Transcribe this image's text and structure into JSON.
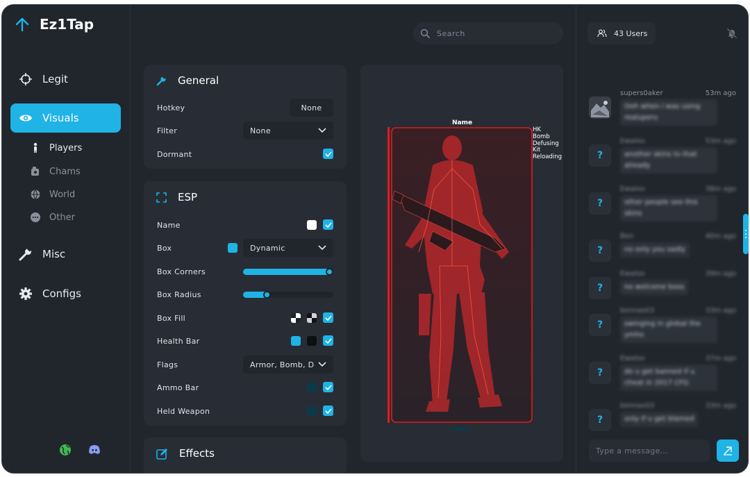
{
  "app": {
    "title": "Ez1Tap"
  },
  "sidebar": {
    "items": [
      {
        "label": "Legit",
        "icon": "crosshair-icon"
      },
      {
        "label": "Visuals",
        "icon": "eye-icon",
        "active": true
      },
      {
        "label": "Misc",
        "icon": "wrench-icon"
      },
      {
        "label": "Configs",
        "icon": "gear-icon"
      }
    ],
    "subitems": [
      {
        "label": "Players",
        "icon": "person-icon",
        "active": true
      },
      {
        "label": "Chams",
        "icon": "paint-icon"
      },
      {
        "label": "World",
        "icon": "globe-icon"
      },
      {
        "label": "Other",
        "icon": "more-icon"
      }
    ],
    "footer_icons": [
      "globe-icon",
      "discord-icon"
    ]
  },
  "search": {
    "placeholder": "Search"
  },
  "general": {
    "title": "General",
    "hotkey_label": "Hotkey",
    "hotkey_value": "None",
    "filter_label": "Filter",
    "filter_value": "None",
    "dormant_label": "Dormant",
    "dormant_checked": true
  },
  "esp": {
    "title": "ESP",
    "name_label": "Name",
    "box_label": "Box",
    "box_value": "Dynamic",
    "box_corners_label": "Box Corners",
    "box_corners_value": 1.0,
    "box_radius_label": "Box Radius",
    "box_radius_value": 0.27,
    "box_fill_label": "Box Fill",
    "health_bar_label": "Health Bar",
    "flags_label": "Flags",
    "flags_value": "Armor, Bomb, D",
    "ammo_bar_label": "Ammo Bar",
    "held_weapon_label": "Held Weapon"
  },
  "effects": {
    "title": "Effects"
  },
  "preview": {
    "name_tag": "Name",
    "flags": [
      "HK",
      "Bomb",
      "Defusing",
      "Kit",
      "Reloading"
    ]
  },
  "chat": {
    "users": "43 Users",
    "messages": [
      {
        "user": "supers0aker",
        "time": "53m ago",
        "text": "Ooh when i was using realuperu"
      },
      {
        "user": "Ewaloo",
        "time": "53m ago",
        "text": "another skins to that already"
      },
      {
        "user": "Ewaloo",
        "time": "38m ago",
        "text": "other people see this skins"
      },
      {
        "user": "Ben",
        "time": "40m ago",
        "text": "no only you sadly"
      },
      {
        "user": "Ewaloo",
        "time": "39m ago",
        "text": "no welcome boss"
      },
      {
        "user": "bennas03",
        "time": "33m ago",
        "text": "swinging in global the ymho"
      },
      {
        "user": "Ewaloo",
        "time": "37m ago",
        "text": "do u get banned if u cheat in 2017 CFG"
      },
      {
        "user": "bennas03",
        "time": "33m ago",
        "text": "only if u get blamed"
      }
    ],
    "input_placeholder": "Type a message..."
  },
  "colors": {
    "accent": "#1fb3e6",
    "box": "#e01b1b",
    "bg": "#21262d",
    "panel": "#282d35"
  }
}
